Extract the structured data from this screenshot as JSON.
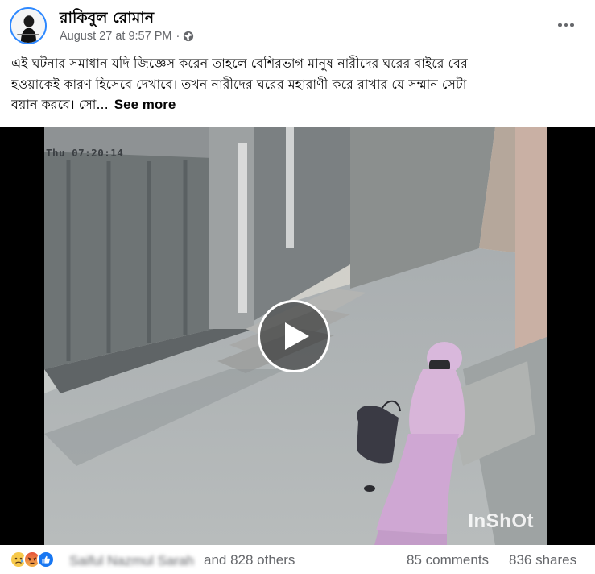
{
  "post": {
    "author": "রাকিবুল রোমান",
    "date": "August 27 at 9:57 PM",
    "separator": "·",
    "privacy_icon": "globe-icon",
    "more_icon": "more-options-icon"
  },
  "caption": {
    "lines": [
      "এই ঘটনার সমাধান যদি জিজ্ঞেস করেন তাহলে বেশিরভাগ মানুষ নারীদের ঘরের বাইরে বের",
      "হওয়াকেই কারণ হিসেবে দেখাবে। তখন নারীদের ঘরের মহারাণী করে রাখার যে সম্মান সেটা",
      "বয়ান করবে। সো..."
    ],
    "see_more": "See more"
  },
  "video": {
    "timestamp": "Thu 07:20:14",
    "watermark": "InShOt",
    "play_icon": "play-icon"
  },
  "engagement": {
    "reactions": [
      "sad-reaction",
      "angry-reaction",
      "like-reaction"
    ],
    "names_blurred": "Saiful Nazmul Sarah",
    "others": "and 828 others",
    "comments": "85 comments",
    "shares": "836 shares"
  },
  "colors": {
    "accent": "#1877f2",
    "secondary_text": "#65676b",
    "primary_text": "#050505"
  }
}
